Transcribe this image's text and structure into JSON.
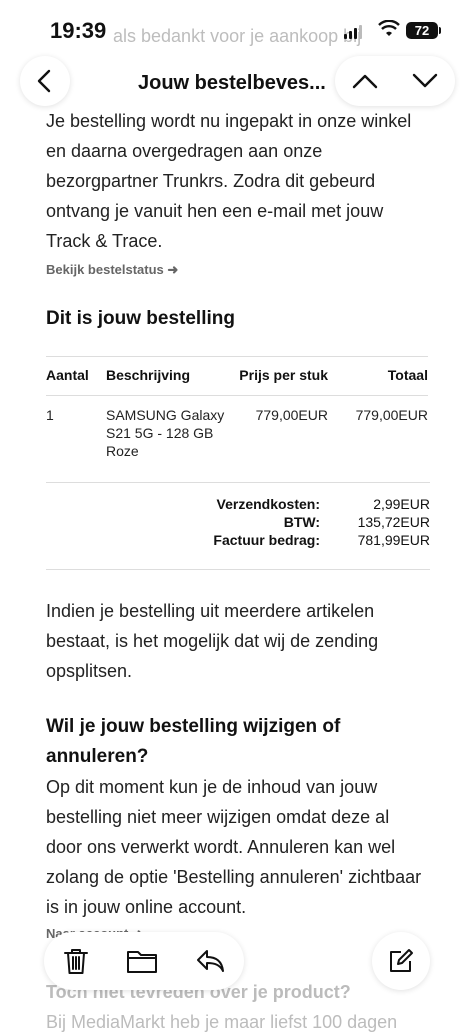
{
  "status": {
    "time": "19:39",
    "battery": "72",
    "bg_text": "als bedankt voor je aankoop bij"
  },
  "nav": {
    "title": "Jouw bestelbeves...",
    "icons": [
      "chevron-left-icon",
      "chevron-up-icon",
      "chevron-down-icon"
    ]
  },
  "email": {
    "intro": "Je bestelling wordt nu ingepakt in onze winkel en daarna overgedragen aan onze bezorgpartner Trunkrs. Zodra dit gebeurd ontvang je vanuit hen een e-mail met jouw Track & Trace.",
    "status_link": "Bekijk bestelstatus ➜",
    "order_heading": "Dit is jouw bestelling",
    "table": {
      "headers": [
        "Aantal",
        "Beschrijving",
        "Prijs per stuk",
        "Totaal"
      ],
      "rows": [
        {
          "qty": "1",
          "description": "SAMSUNG Galaxy S21 5G - 128 GB Roze",
          "unit_price": "779,00EUR",
          "total": "779,00EUR"
        }
      ]
    },
    "totals": {
      "shipping_label": "Verzendkosten:",
      "shipping_value": "2,99EUR",
      "vat_label": "BTW:",
      "vat_value": "135,72EUR",
      "invoice_label": "Factuur bedrag:",
      "invoice_value": "781,99EUR"
    },
    "split_text": "Indien je bestelling uit meerdere artikelen bestaat, is het mogelijk dat wij de zending opsplitsen.",
    "change_heading": "Wil je jouw bestelling wijzigen of annuleren?",
    "change_text": "Op dit moment kun je de inhoud van jouw bestelling niet meer wijzigen omdat deze al door ons verwerkt wordt. Annuleren kan wel zolang de optie 'Bestelling annuleren' zichtbaar is in jouw online account.",
    "account_link": "Naar account ➜",
    "faded_heading": "Toch niet tevreden over je product?",
    "faded_text": "Bij MediaMarkt heb je maar liefst 100 dagen"
  },
  "toolbar": {
    "icons": [
      "trash-icon",
      "folder-icon",
      "reply-icon",
      "compose-icon"
    ]
  }
}
